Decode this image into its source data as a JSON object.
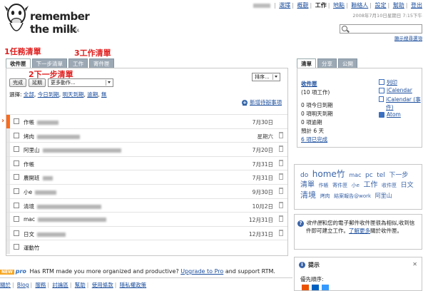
{
  "brand": {
    "line1": "remember",
    "line2": "the milk",
    "beta": "BETA"
  },
  "topnav": {
    "items": [
      {
        "label": "選擇",
        "current": false
      },
      {
        "label": "概觀",
        "current": false
      },
      {
        "label": "工作",
        "current": true
      },
      {
        "label": "地點",
        "current": false
      },
      {
        "label": "聯絡人",
        "current": false
      },
      {
        "label": "設定",
        "current": false
      },
      {
        "label": "幫助",
        "current": false
      },
      {
        "label": "登出",
        "current": false
      }
    ],
    "datetime": "2008年7月10日星期日 7:15下午"
  },
  "search": {
    "placeholder": "",
    "options_link": "顯示搜尋選項"
  },
  "annotations": {
    "a1": "1任務清單",
    "a2": "2下一步清單",
    "a3": "3工作清單"
  },
  "tabs": [
    {
      "label": "收件匣",
      "active": true
    },
    {
      "label": "下一步清單",
      "active": false
    },
    {
      "label": "工作",
      "active": false
    },
    {
      "label": "寄件匣",
      "active": false
    }
  ],
  "toolbar": {
    "complete": "完成",
    "postpone": "延期",
    "more_actions": "更多動作...",
    "sort": "排序..."
  },
  "select_row": {
    "label": "選擇:",
    "all": "全部",
    "due_today": "今日到期",
    "due_tomorrow": "明天到期",
    "overdue": "逾期",
    "none": "無"
  },
  "add_task": "新增待辦事項",
  "tasks": [
    {
      "name": "作帳",
      "due": "7月30日"
    },
    {
      "name": "烤肉",
      "due": "星期六"
    },
    {
      "name": "阿里山",
      "due": "7月20日"
    },
    {
      "name": "作帳",
      "due": "7月31日"
    },
    {
      "name": "農開班",
      "due": "7月31日"
    },
    {
      "name": "小e",
      "due": "9月30日"
    },
    {
      "name": "清境",
      "due": "10月2日"
    },
    {
      "name": "mac",
      "due": "12月31日"
    },
    {
      "name": "日文",
      "due": "12月31日"
    },
    {
      "name": "運動竹",
      "due": ""
    }
  ],
  "promo": {
    "badge": "NEW",
    "pro": "pro",
    "text1": "Has RTM made you more organized and productive?",
    "link": "Upgrade to Pro",
    "text2": "and support RTM."
  },
  "footer": [
    "關於",
    "Blog",
    "服務",
    "討論區",
    "幫助",
    "使用條款",
    "隱私權政策"
  ],
  "right_tabs": [
    {
      "label": "清單",
      "active": true
    },
    {
      "label": "分享",
      "active": false
    },
    {
      "label": "公開",
      "active": false
    }
  ],
  "right_panel": {
    "title": "收件匣",
    "count": "(10 項工作)",
    "stats": [
      "0 項今日到期",
      "0 項明天到期",
      "0 項逾期",
      "預計 6 天"
    ],
    "completed_link": "6 項已完成",
    "links": [
      "列印",
      "iCalendar",
      "iCalendar (事件)",
      "Atom"
    ]
  },
  "tag_cloud": [
    "do",
    "home竹",
    "mac",
    "pc",
    "tel",
    "下一步",
    "清單",
    "作帳",
    "寄件匣",
    "小e",
    "工作",
    "收件匣",
    "日文",
    "清境",
    "烤肉",
    "結案報告@work",
    "阿里山"
  ],
  "info": {
    "text1": "收件匣",
    "text2": "和您的電子郵件收件匣很為相似,收到信件即可建立工作。",
    "link": "了解更多",
    "text3": "關於收件匣。"
  },
  "tips": {
    "title": "提示",
    "priority_label": "優先順序:"
  },
  "colors": {
    "accent": "#ff6a1a",
    "link": "#1a4d9c",
    "tab_inactive": "#9ca9b5",
    "annotation": "#e02020"
  }
}
